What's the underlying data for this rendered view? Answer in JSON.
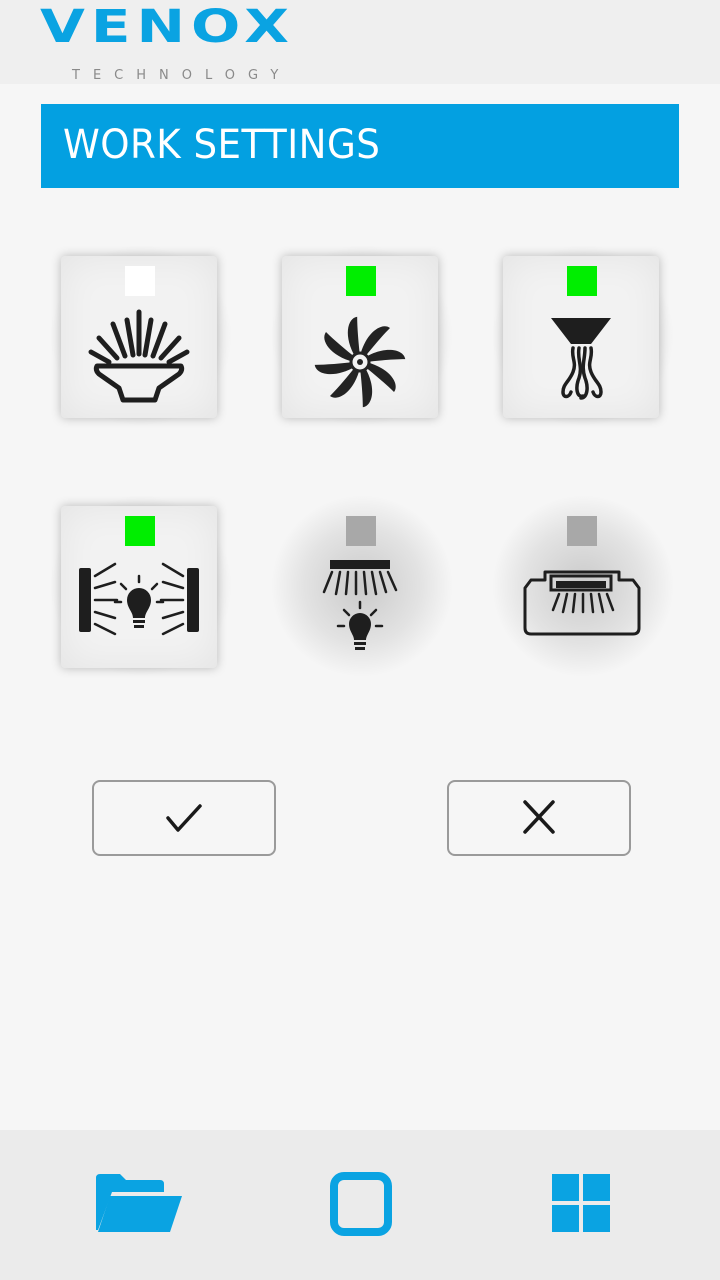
{
  "brand": {
    "name": "VENOX",
    "tagline": "TECHNOLOGY",
    "color": "#0aa3e2"
  },
  "title_bar": {
    "title": "WORK SETTINGS",
    "color": "#03a0e1"
  },
  "tiles": [
    {
      "icon": "surface-light-icon",
      "status": "off",
      "status_color": "#ffffff",
      "enabled": true
    },
    {
      "icon": "fan-icon",
      "status": "on",
      "status_color": "#00ee00",
      "enabled": true
    },
    {
      "icon": "extractor-hood-icon",
      "status": "on",
      "status_color": "#00ee00",
      "enabled": true
    },
    {
      "icon": "side-lights-icon",
      "status": "on",
      "status_color": "#00ee00",
      "enabled": true
    },
    {
      "icon": "ceiling-light-icon",
      "status": "unavailable",
      "status_color": "#a8a8a8",
      "enabled": false
    },
    {
      "icon": "bottom-light-icon",
      "status": "unavailable",
      "status_color": "#a8a8a8",
      "enabled": false
    }
  ],
  "actions": {
    "confirm_icon": "check-icon",
    "cancel_icon": "close-icon"
  },
  "nav": [
    {
      "icon": "folder-icon"
    },
    {
      "icon": "square-icon"
    },
    {
      "icon": "grid-icon"
    }
  ],
  "accent_color": "#03a0e1"
}
